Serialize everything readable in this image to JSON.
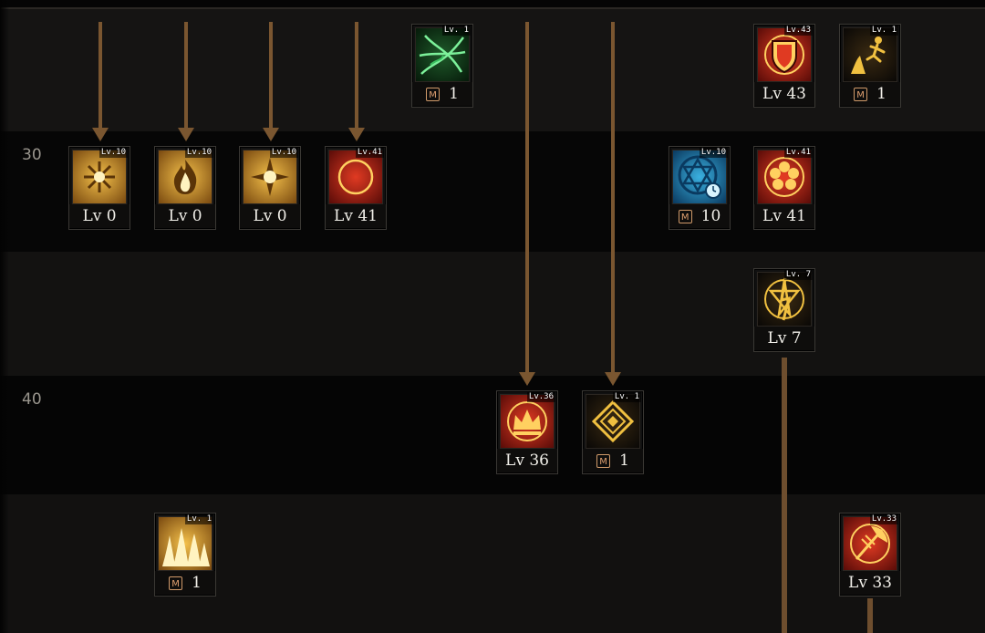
{
  "row_labels": [
    {
      "text": "30"
    },
    {
      "text": "40"
    }
  ],
  "skills": [
    {
      "id": "s1",
      "lv_tag": "Lv. 1",
      "caption": "1",
      "badge": "M",
      "theme": "green",
      "glyph": "vines"
    },
    {
      "id": "s2",
      "lv_tag": "Lv.43",
      "caption": "Lv 43",
      "badge": "",
      "theme": "red",
      "glyph": "shield"
    },
    {
      "id": "s3",
      "lv_tag": "Lv. 1",
      "caption": "1",
      "badge": "M",
      "theme": "dark",
      "glyph": "figure"
    },
    {
      "id": "s4",
      "lv_tag": "Lv.10",
      "caption": "Lv 0",
      "badge": "",
      "theme": "gold",
      "glyph": "snowflake"
    },
    {
      "id": "s5",
      "lv_tag": "Lv.10",
      "caption": "Lv 0",
      "badge": "",
      "theme": "gold",
      "glyph": "flame"
    },
    {
      "id": "s6",
      "lv_tag": "Lv.10",
      "caption": "Lv 0",
      "badge": "",
      "theme": "gold",
      "glyph": "sun"
    },
    {
      "id": "s7",
      "lv_tag": "Lv.41",
      "caption": "Lv 41",
      "badge": "",
      "theme": "red",
      "glyph": "moon"
    },
    {
      "id": "s8",
      "lv_tag": "Lv.10",
      "caption": "10",
      "badge": "M",
      "theme": "blue",
      "glyph": "hexagram"
    },
    {
      "id": "s9",
      "lv_tag": "Lv.41",
      "caption": "Lv 41",
      "badge": "",
      "theme": "red",
      "glyph": "flower"
    },
    {
      "id": "s10",
      "lv_tag": "Lv. 7",
      "caption": "Lv 7",
      "badge": "",
      "theme": "dark",
      "glyph": "star"
    },
    {
      "id": "s11",
      "lv_tag": "Lv.36",
      "caption": "Lv 36",
      "badge": "",
      "theme": "red",
      "glyph": "crown"
    },
    {
      "id": "s12",
      "lv_tag": "Lv. 1",
      "caption": "1",
      "badge": "M",
      "theme": "dark",
      "glyph": "diamond"
    },
    {
      "id": "s13",
      "lv_tag": "Lv. 1",
      "caption": "1",
      "badge": "M",
      "theme": "gold",
      "glyph": "fire-wall"
    },
    {
      "id": "s14",
      "lv_tag": "Lv.33",
      "caption": "Lv 33",
      "badge": "",
      "theme": "red",
      "glyph": "axe"
    }
  ],
  "colors": {
    "arrow": "#7a5630",
    "caption_text": "#f2f0ea",
    "badge": "#e0a070",
    "row_label": "#9a968e"
  }
}
